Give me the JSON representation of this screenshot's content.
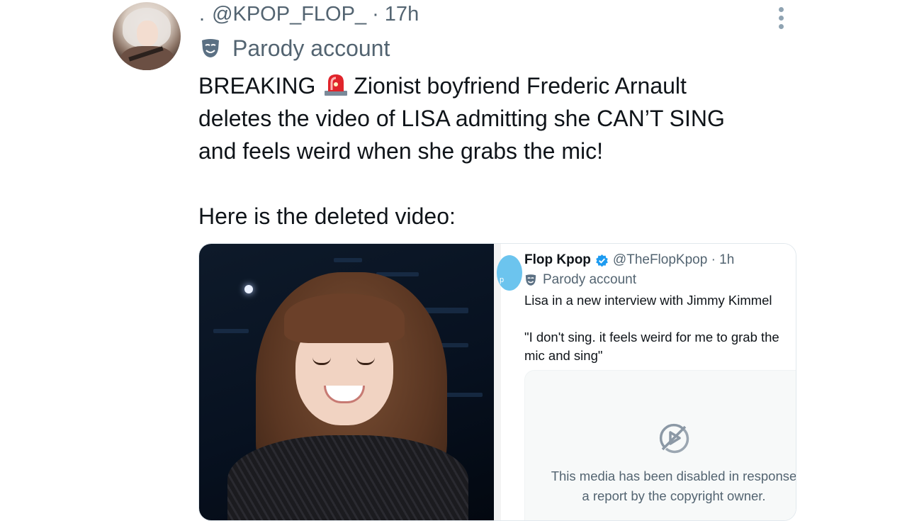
{
  "tweet": {
    "separator": ".",
    "handle": "@KPOP_FLOP_",
    "time": "· 17h",
    "parody_label": "Parody account",
    "text_line_1": "BREAKING",
    "text_line_1_rest": "Zionist boyfriend Frederic Arnault",
    "text_line_2": "deletes the video of LISA admitting she CAN’T SING",
    "text_line_3": "and feels weird when she grabs the mic!",
    "text_para_2": "Here is the deleted video:"
  },
  "embedded_tweet": {
    "avatar_text": "p",
    "name": "Flop Kpop",
    "handle_time": "@TheFlopKpop · 1h",
    "parody_label": "Parody account",
    "line_1": "Lisa in a new interview with Jimmy Kimmel",
    "quote_line_1": "\"I don't sing. it feels weird for me to grab the",
    "quote_line_2": "mic and sing\"",
    "disabled_line_1": "This media has been disabled in response",
    "disabled_line_2": "a report by the copyright owner."
  },
  "icons": {
    "avatar": "profile-photo",
    "parody": "theater-mask-icon",
    "siren": "police-light-emoji",
    "verified": "verified-badge-icon",
    "media_disabled": "disabled-media-icon",
    "menu": "more-options-icon"
  },
  "colors": {
    "text": "#0f1419",
    "secondary": "#536471",
    "verified": "#1d9bf0",
    "siren": "#e0242b"
  }
}
